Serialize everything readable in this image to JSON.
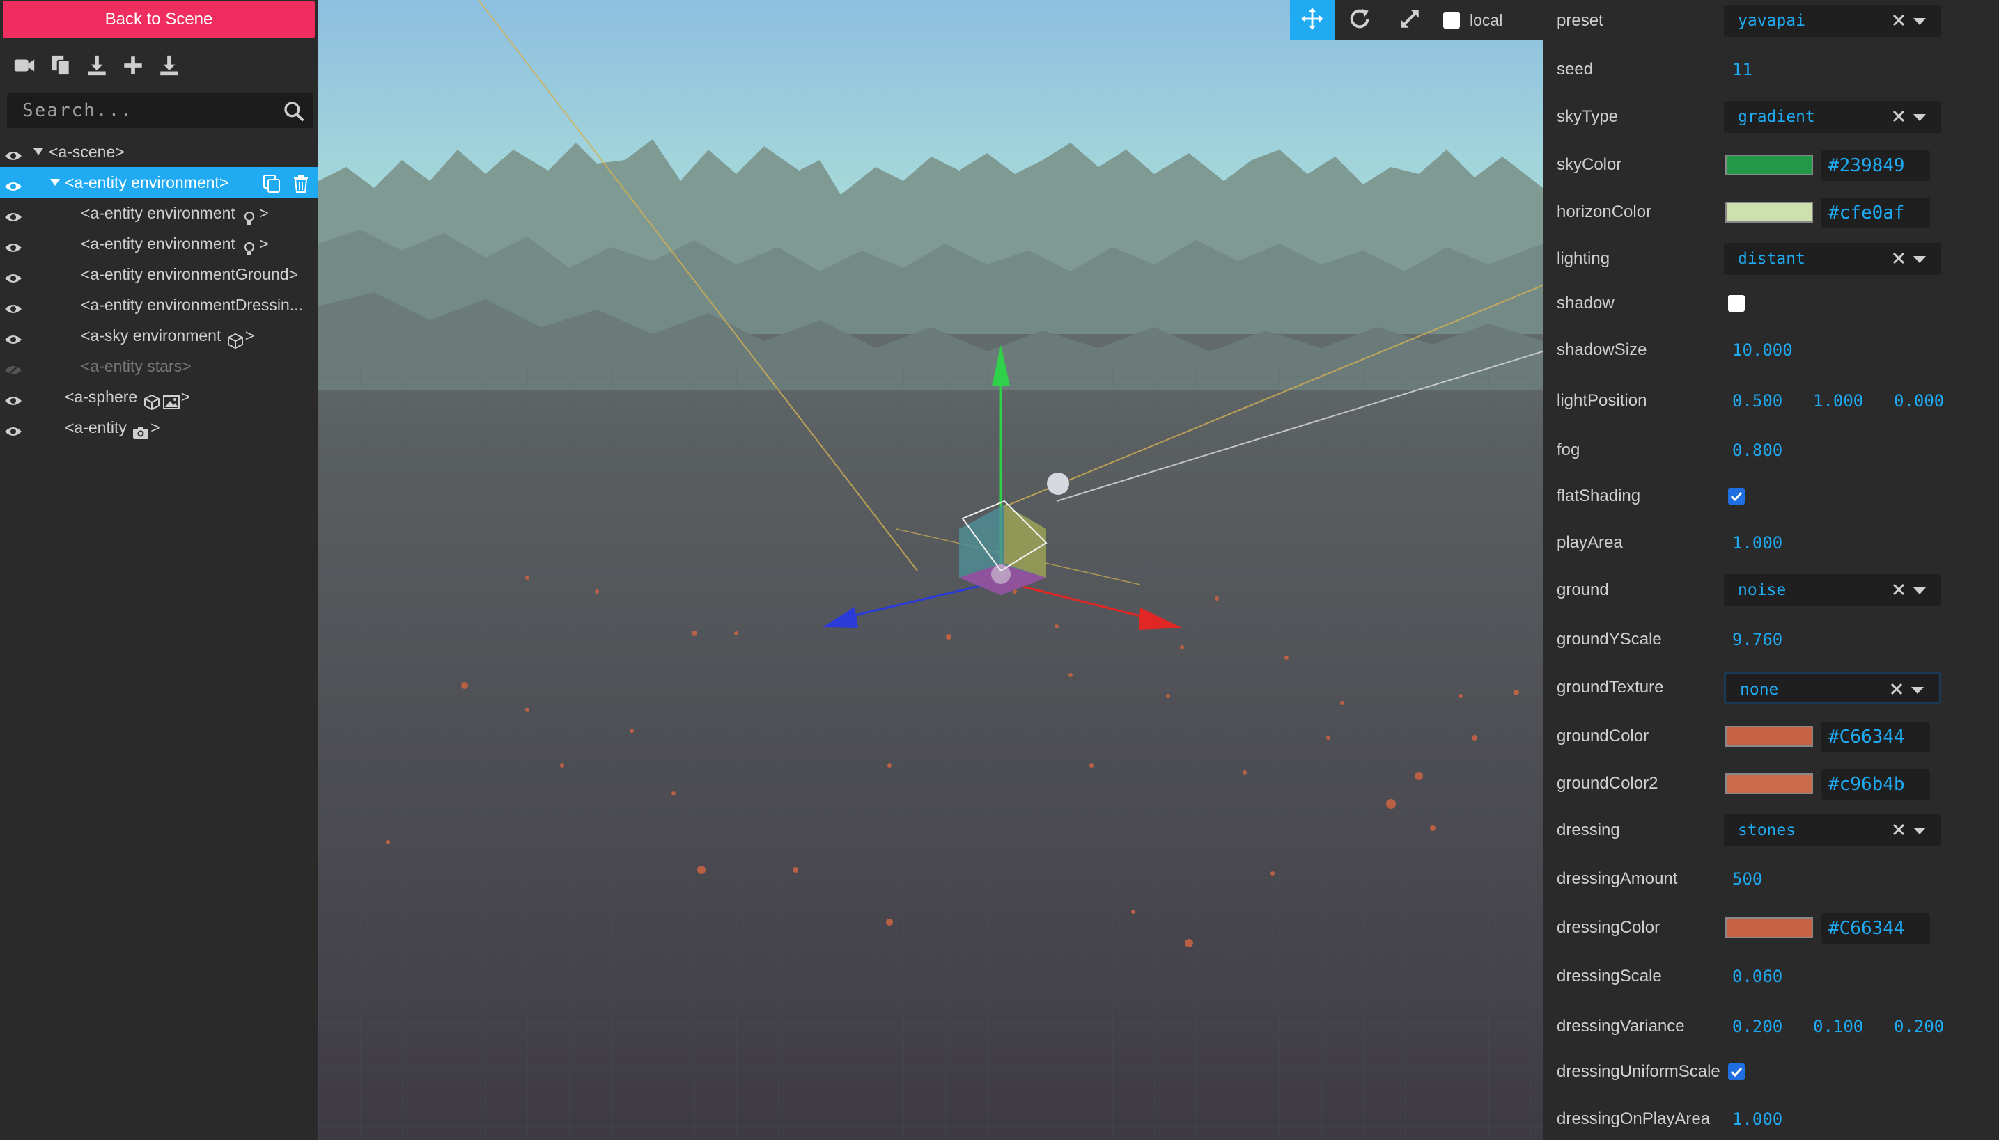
{
  "left_panel": {
    "back_button": "Back to Scene",
    "toolbar_icons": [
      "camera-icon",
      "copy-icon",
      "download-icon",
      "add-icon",
      "export-icon"
    ],
    "search_placeholder": "Search..."
  },
  "tree": [
    {
      "label": "<a-scene>"
    },
    {
      "label": "<a-entity environment>"
    },
    {
      "label": "<a-entity environment ",
      "suffix": ">"
    },
    {
      "label": "<a-entity environment ",
      "suffix": ">"
    },
    {
      "label": "<a-entity environmentGround>"
    },
    {
      "label": "<a-entity environmentDressin..."
    },
    {
      "label": "<a-sky environment ",
      "suffix": ">"
    },
    {
      "label": "<a-entity stars>"
    },
    {
      "label": "<a-sphere ",
      "suffix": ">"
    },
    {
      "label": "<a-entity ",
      "suffix": ">"
    }
  ],
  "viewport_toolbar": {
    "tools": [
      "translate-icon",
      "rotate-icon",
      "scale-icon"
    ],
    "local_label": "local",
    "local_checked": false
  },
  "properties": {
    "preset": {
      "label": "preset",
      "value": "yavapai"
    },
    "seed": {
      "label": "seed",
      "value": "11"
    },
    "skyType": {
      "label": "skyType",
      "value": "gradient"
    },
    "skyColor": {
      "label": "skyColor",
      "value": "#239849",
      "color": "#239849"
    },
    "horizonColor": {
      "label": "horizonColor",
      "value": "#cfe0af",
      "color": "#cfe0af"
    },
    "lighting": {
      "label": "lighting",
      "value": "distant"
    },
    "shadow": {
      "label": "shadow",
      "checked": false
    },
    "shadowSize": {
      "label": "shadowSize",
      "value": "10.000"
    },
    "lightPosition": {
      "label": "lightPosition",
      "x": "0.500",
      "y": "1.000",
      "z": "0.000"
    },
    "fog": {
      "label": "fog",
      "value": "0.800"
    },
    "flatShading": {
      "label": "flatShading",
      "checked": true
    },
    "playArea": {
      "label": "playArea",
      "value": "1.000"
    },
    "ground": {
      "label": "ground",
      "value": "noise"
    },
    "groundYScale": {
      "label": "groundYScale",
      "value": "9.760"
    },
    "groundTexture": {
      "label": "groundTexture",
      "value": "none"
    },
    "groundColor": {
      "label": "groundColor",
      "value": "#C66344",
      "color": "#C66344"
    },
    "groundColor2": {
      "label": "groundColor2",
      "value": "#c96b4b",
      "color": "#c96b4b"
    },
    "dressing": {
      "label": "dressing",
      "value": "stones"
    },
    "dressingAmount": {
      "label": "dressingAmount",
      "value": "500"
    },
    "dressingColor": {
      "label": "dressingColor",
      "value": "#C66344",
      "color": "#C66344"
    },
    "dressingScale": {
      "label": "dressingScale",
      "value": "0.060"
    },
    "dressingVariance": {
      "label": "dressingVariance",
      "x": "0.200",
      "y": "0.100",
      "z": "0.200"
    },
    "dressingUniformScale": {
      "label": "dressingUniformScale",
      "checked": true
    },
    "dressingOnPlayArea": {
      "label": "dressingOnPlayArea",
      "value": "1.000"
    }
  },
  "colors": {
    "accent": "#1faaf2",
    "back_button": "#ef2d5e",
    "panel": "#2a2a2a"
  }
}
